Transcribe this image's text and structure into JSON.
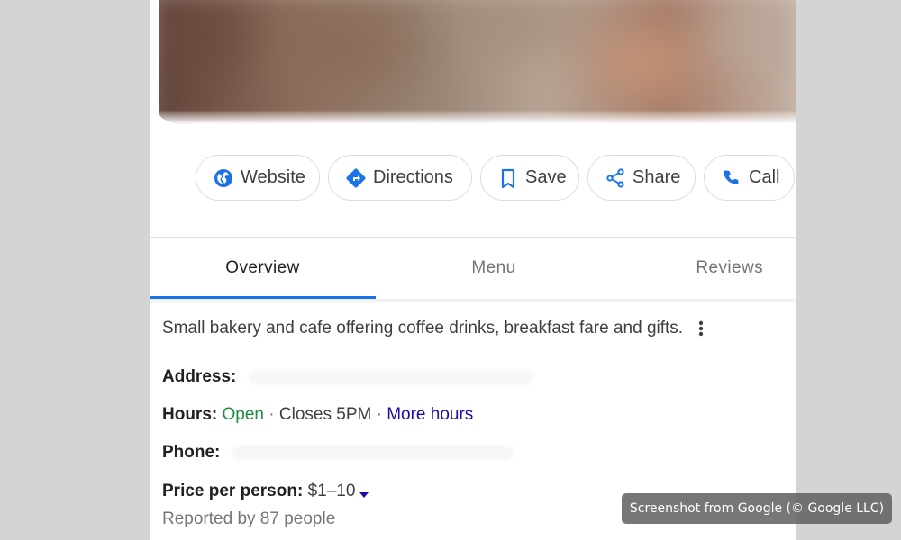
{
  "actions": {
    "website": "Website",
    "directions": "Directions",
    "save": "Save",
    "share": "Share",
    "call": "Call"
  },
  "tabs": {
    "overview": "Overview",
    "menu": "Menu",
    "reviews": "Reviews",
    "active": "Overview"
  },
  "overview": {
    "description": "Small bakery and cafe offering coffee drinks, breakfast fare and gifts.",
    "address_label": "Address:",
    "hours_label": "Hours:",
    "hours_status": "Open",
    "hours_sep1": " · ",
    "hours_close": "Closes 5PM",
    "hours_sep2": " · ",
    "more_hours": "More hours",
    "phone_label": "Phone:",
    "price_label": "Price per person:",
    "price_value": "$1–10",
    "reported": "Reported by 87 people"
  },
  "credit": "Screenshot from Google (© Google LLC)",
  "colors": {
    "accent_blue": "#1a73e8",
    "open_green": "#1e8e3e",
    "link_blue": "#1a0dab",
    "page_gray": "#d4d4d4"
  },
  "icons": [
    "globe-icon",
    "directions-icon",
    "bookmark-icon",
    "share-icon",
    "phone-icon",
    "more-vert-icon",
    "caret-down-icon"
  ]
}
